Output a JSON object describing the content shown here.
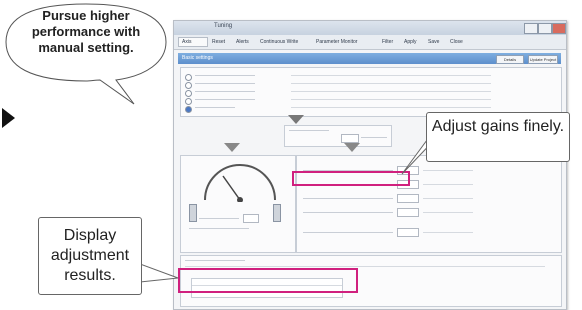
{
  "callouts": {
    "top_left": "Pursue higher performance with manual setting.",
    "right": "Adjust gains finely.",
    "bottom_left": "Display adjustment results."
  },
  "window": {
    "title": "Tuning",
    "toolbar": {
      "axis": "Axis",
      "items": [
        "Reset",
        "Alerts",
        "Continuous Write",
        "Parameter Monitor",
        "Filter",
        "Apply",
        "Save",
        "Close"
      ]
    },
    "section_bar": "Basic settings",
    "bar_buttons": [
      "Details",
      "Update Project"
    ]
  },
  "colors": {
    "highlight": "#d0207e",
    "title_bar": "#5d8fcc"
  }
}
